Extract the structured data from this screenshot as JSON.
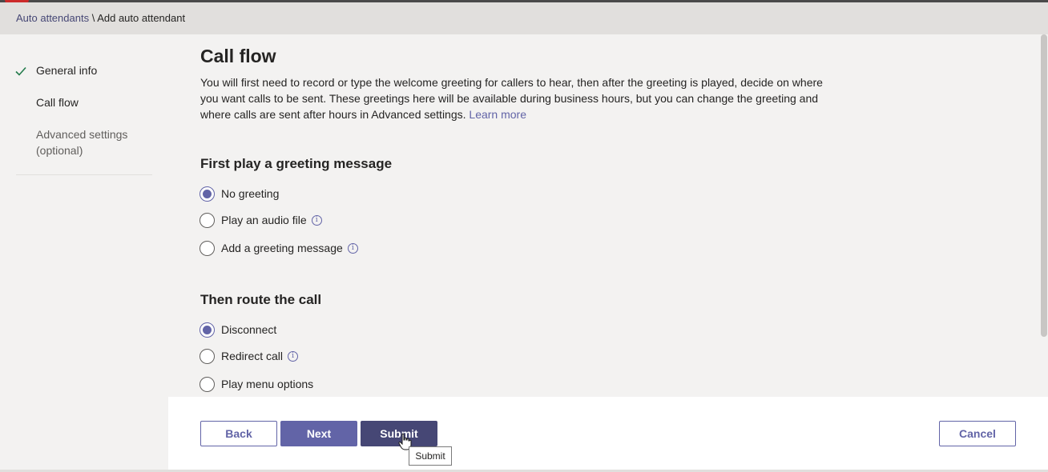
{
  "breadcrumb": {
    "parent": "Auto attendants",
    "separator": " \\ ",
    "current": "Add auto attendant"
  },
  "steps": [
    {
      "label": "General info",
      "status": "completed"
    },
    {
      "label": "Call flow",
      "status": "current"
    },
    {
      "label": "Advanced settings (optional)",
      "status": "upcoming"
    }
  ],
  "main": {
    "title": "Call flow",
    "description": "You will first need to record or type the welcome greeting for callers to hear, then after the greeting is played, decide on where you want calls to be sent. These greetings here will be available during business hours, but you can change the greeting and where calls are sent after hours in Advanced settings.",
    "learn_more": "Learn more",
    "greeting": {
      "title": "First play a greeting message",
      "options": [
        {
          "label": "No greeting",
          "selected": true,
          "info": false
        },
        {
          "label": "Play an audio file",
          "selected": false,
          "info": true
        },
        {
          "label": "Add a greeting message",
          "selected": false,
          "info": true
        }
      ]
    },
    "route": {
      "title": "Then route the call",
      "options": [
        {
          "label": "Disconnect",
          "selected": true,
          "info": false
        },
        {
          "label": "Redirect call",
          "selected": false,
          "info": true
        },
        {
          "label": "Play menu options",
          "selected": false,
          "info": false
        }
      ]
    }
  },
  "footer": {
    "back_label": "Back",
    "next_label": "Next",
    "submit_label": "Submit",
    "cancel_label": "Cancel",
    "tooltip": "Submit"
  },
  "colors": {
    "accent": "#6264a7",
    "accent_dark": "#464775",
    "check": "#237b4b"
  }
}
